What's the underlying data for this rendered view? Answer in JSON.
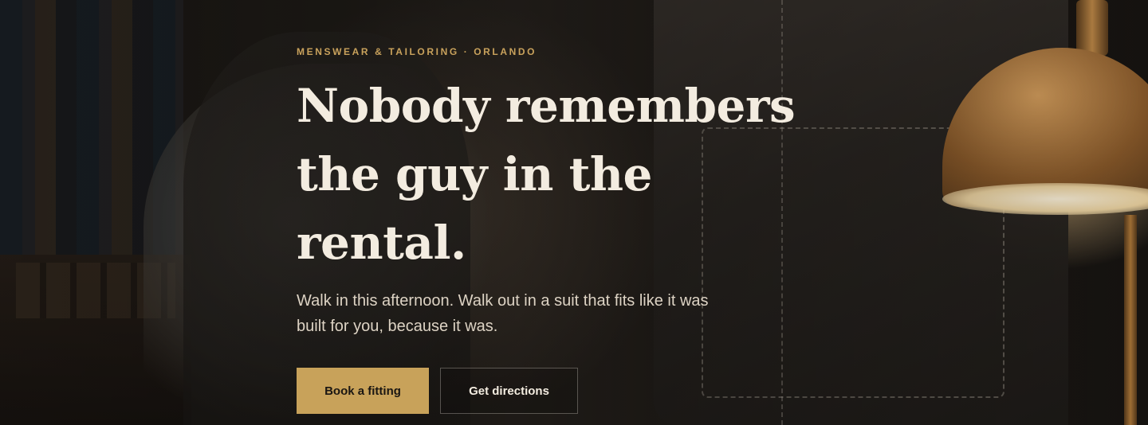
{
  "hero": {
    "eyebrow": "MENSWEAR & TAILORING · ORLANDO",
    "headline_lines": [
      "Nobody remembers",
      "the guy in the",
      "rental."
    ],
    "subtext_lines": [
      "Walk in this afternoon. Walk out in a suit that fits like it was",
      "built for you, because it was."
    ],
    "primary_button": "Book a fitting",
    "secondary_button": "Get directions"
  },
  "colors": {
    "accent": "#c8a25a",
    "eyebrow": "#c9a25c",
    "headline": "#f3ece0",
    "background": "#1a1612"
  }
}
